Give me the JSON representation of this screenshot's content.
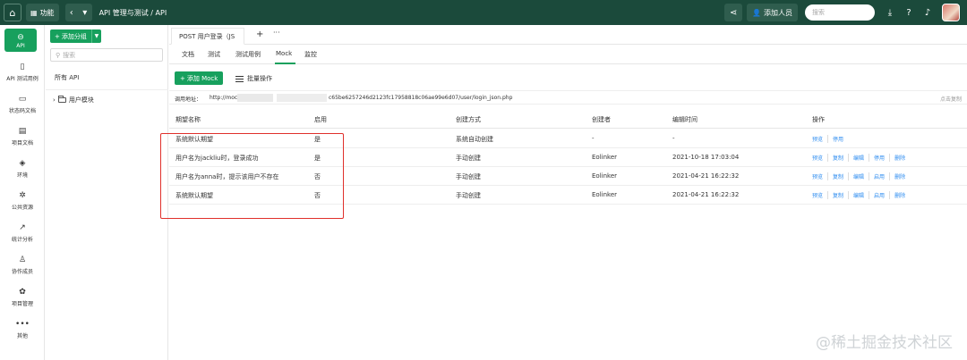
{
  "topbar": {
    "apps_label": "功能",
    "breadcrumb": "API 管理与测试 / API",
    "add_member_label": "添加人员",
    "search_placeholder": "搜索"
  },
  "rail": [
    {
      "label": "API",
      "icon": "link-icon",
      "active": true
    },
    {
      "label": "API 测试用例",
      "icon": "test-case-icon"
    },
    {
      "label": "状态码文档",
      "icon": "status-code-icon"
    },
    {
      "label": "项目文档",
      "icon": "doc-icon"
    },
    {
      "label": "环境",
      "icon": "environment-icon"
    },
    {
      "label": "公共资源",
      "icon": "gear-icon"
    },
    {
      "label": "统计分析",
      "icon": "chart-icon"
    },
    {
      "label": "协作成员",
      "icon": "member-icon"
    },
    {
      "label": "项目管理",
      "icon": "settings-icon"
    },
    {
      "label": "其他",
      "icon": "more-icon"
    }
  ],
  "tree": {
    "add_group_label": "添加分组",
    "search_placeholder": "搜索",
    "all_api": "所有 API",
    "folder": "用户模块"
  },
  "doc_tab": "POST 用户登录（JS",
  "sub_tabs": [
    "文档",
    "测试",
    "测试用例",
    "Mock",
    "监控"
  ],
  "active_sub_tab": "Mock",
  "actions": {
    "add_mock": "添加 Mock",
    "batch": "批量操作"
  },
  "url": {
    "label": "调用地址：",
    "prefix": "http://mock",
    "tail": "c65be6257246d2123fc17958818c06ae99e6d07/user/login_json.php",
    "copy": "点击复制"
  },
  "table": {
    "headers": [
      "期望名称",
      "启用",
      "创建方式",
      "创建者",
      "编辑时间",
      "操作"
    ],
    "rows": [
      {
        "name": "系统默认期望",
        "enabled": "是",
        "method": "系统自动创建",
        "creator": "-",
        "time": "-",
        "ops": [
          "预览",
          "停用"
        ]
      },
      {
        "name": "用户名为jackliu时，登录成功",
        "enabled": "是",
        "method": "手动创建",
        "creator": "Eolinker",
        "time": "2021-10-18 17:03:04",
        "ops": [
          "预览",
          "复制",
          "编辑",
          "停用",
          "删除"
        ]
      },
      {
        "name": "用户名为anna时，提示该用户不存在",
        "enabled": "否",
        "method": "手动创建",
        "creator": "Eolinker",
        "time": "2021-04-21 16:22:32",
        "ops": [
          "预览",
          "复制",
          "编辑",
          "启用",
          "删除"
        ]
      },
      {
        "name": "系统默认期望",
        "enabled": "否",
        "method": "手动创建",
        "creator": "Eolinker",
        "time": "2021-04-21 16:22:32",
        "ops": [
          "预览",
          "复制",
          "编辑",
          "启用",
          "删除"
        ]
      }
    ]
  },
  "watermark": "@稀土掘金技术社区",
  "colors": {
    "topbar": "#1b4a3b",
    "accent": "#17a05d",
    "link": "#2d8cf0",
    "highlight": "#e0302b"
  }
}
